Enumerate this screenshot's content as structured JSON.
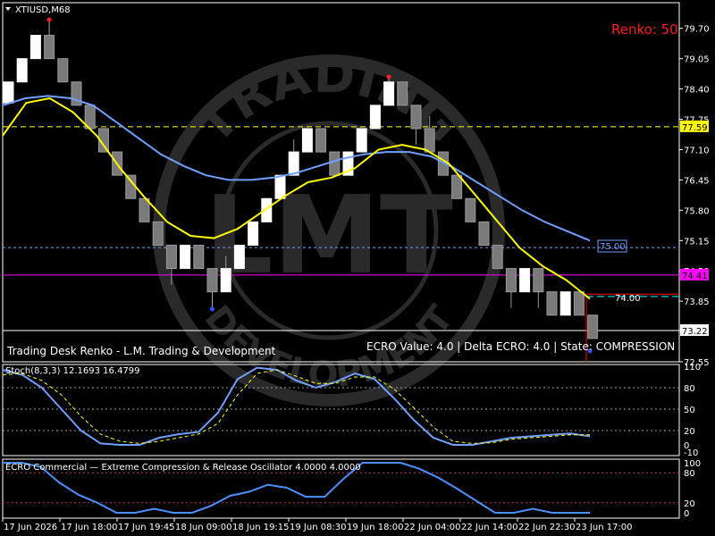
{
  "symbol_label": "XTIUSD,M68",
  "renko_label": "Renko: 50",
  "footer_left": "Trading Desk Renko - L.M. Trading & Development",
  "footer_right": "ECRO Value: 4.0   |   Delta ECRO: 4.0   |   State: COMPRESSION",
  "watermark": {
    "text_top": "TRADING",
    "text_center": "LMT",
    "text_bottom": "DEVELOPMENT"
  },
  "price_axis": [
    "79.70",
    "79.05",
    "78.40",
    "77.75",
    "77.10",
    "76.45",
    "75.80",
    "75.15",
    "74.50",
    "73.85",
    "73.22",
    "72.55"
  ],
  "price_markers": [
    {
      "value": "77.59",
      "color": "#ffff00",
      "text_color": "#000000"
    },
    {
      "value": "74.41",
      "color": "#ff00ff",
      "text_color": "#000000"
    },
    {
      "value": "73.22",
      "color": "#ffffff",
      "text_color": "#000000"
    }
  ],
  "line_labels": [
    {
      "text": "75.00",
      "color": "#6f9fff"
    },
    {
      "text": "74.00",
      "color": "#ffffff"
    }
  ],
  "stoch": {
    "label": "Stoch(8,3,3) 12.1693 16.4799",
    "axis": [
      "110",
      "80",
      "50",
      "20",
      "0",
      "-10"
    ]
  },
  "ecro": {
    "label": "ECRO Commercial — Extreme Compression & Release Oscillator 4.0000 4.0000",
    "axis": [
      "100",
      "80",
      "20",
      "0"
    ]
  },
  "time_axis": [
    "17 Jun 2026",
    "17 Jun 18:00",
    "17 Jun 19:45",
    "18 Jun 09:00",
    "18 Jun 19:15",
    "19 Jun 08:30",
    "19 Jun 18:00",
    "22 Jun 04:00",
    "22 Jun 14:00",
    "22 Jun 22:30",
    "23 Jun 17:00"
  ],
  "chart_data": {
    "type": "candlestick",
    "bricks": [
      {
        "o": 78.1,
        "c": 78.55
      },
      {
        "o": 78.55,
        "c": 79.05
      },
      {
        "o": 79.05,
        "c": 79.55
      },
      {
        "o": 79.55,
        "c": 79.05
      },
      {
        "o": 79.05,
        "c": 78.55
      },
      {
        "o": 78.55,
        "c": 78.05
      },
      {
        "o": 78.05,
        "c": 77.55
      },
      {
        "o": 77.55,
        "c": 77.05
      },
      {
        "o": 77.05,
        "c": 76.55
      },
      {
        "o": 76.55,
        "c": 76.05
      },
      {
        "o": 76.05,
        "c": 75.55
      },
      {
        "o": 75.55,
        "c": 75.05
      },
      {
        "o": 75.05,
        "c": 74.55
      },
      {
        "o": 74.55,
        "c": 75.05
      },
      {
        "o": 75.05,
        "c": 74.55
      },
      {
        "o": 74.55,
        "c": 74.05
      },
      {
        "o": 74.05,
        "c": 74.55
      },
      {
        "o": 74.55,
        "c": 75.05
      },
      {
        "o": 75.05,
        "c": 75.55
      },
      {
        "o": 75.55,
        "c": 76.05
      },
      {
        "o": 76.05,
        "c": 76.55
      },
      {
        "o": 76.55,
        "c": 77.05
      },
      {
        "o": 77.05,
        "c": 77.55
      },
      {
        "o": 77.55,
        "c": 77.05
      },
      {
        "o": 77.05,
        "c": 76.55
      },
      {
        "o": 76.55,
        "c": 77.05
      },
      {
        "o": 77.05,
        "c": 77.55
      },
      {
        "o": 77.55,
        "c": 78.05
      },
      {
        "o": 78.05,
        "c": 78.55
      },
      {
        "o": 78.55,
        "c": 78.05
      },
      {
        "o": 78.05,
        "c": 77.55
      },
      {
        "o": 77.55,
        "c": 77.05
      },
      {
        "o": 77.05,
        "c": 76.55
      },
      {
        "o": 76.55,
        "c": 76.05
      },
      {
        "o": 76.05,
        "c": 75.55
      },
      {
        "o": 75.55,
        "c": 75.05
      },
      {
        "o": 75.05,
        "c": 74.55
      },
      {
        "o": 74.55,
        "c": 74.05
      },
      {
        "o": 74.05,
        "c": 74.55
      },
      {
        "o": 74.55,
        "c": 74.05
      },
      {
        "o": 74.05,
        "c": 73.55
      },
      {
        "o": 73.55,
        "c": 74.05
      },
      {
        "o": 74.05,
        "c": 73.55
      },
      {
        "o": 73.55,
        "c": 73.05
      }
    ],
    "ma_blue": [
      78.05,
      78.2,
      78.25,
      78.2,
      78.05,
      77.7,
      77.35,
      77.0,
      76.75,
      76.55,
      76.45,
      76.45,
      76.5,
      76.6,
      76.75,
      76.9,
      77.0,
      77.05,
      77.05,
      76.95,
      76.7,
      76.4,
      76.1,
      75.8,
      75.55,
      75.35,
      75.15
    ],
    "ma_yellow": [
      77.4,
      78.1,
      78.2,
      77.9,
      77.4,
      76.7,
      76.1,
      75.55,
      75.25,
      75.2,
      75.4,
      75.75,
      76.1,
      76.4,
      76.5,
      76.7,
      77.1,
      77.2,
      77.1,
      76.8,
      76.2,
      75.6,
      75.0,
      74.6,
      74.3,
      73.9
    ],
    "stoch_main": [
      105,
      98,
      80,
      50,
      20,
      2,
      0,
      0,
      10,
      15,
      18,
      45,
      92,
      108,
      105,
      90,
      80,
      88,
      100,
      92,
      65,
      35,
      10,
      0,
      0,
      5,
      10,
      12,
      14,
      16,
      12
    ],
    "stoch_signal": [
      98,
      100,
      90,
      70,
      40,
      15,
      5,
      2,
      5,
      10,
      15,
      30,
      70,
      100,
      105,
      96,
      86,
      86,
      95,
      95,
      78,
      52,
      25,
      5,
      2,
      3,
      8,
      10,
      12,
      14,
      14
    ],
    "ecro_values": [
      100,
      100,
      92,
      60,
      36,
      20,
      0,
      0,
      8,
      0,
      0,
      14,
      34,
      42,
      56,
      50,
      32,
      32,
      68,
      100,
      100,
      100,
      88,
      70,
      48,
      24,
      0,
      0,
      8,
      0,
      0,
      0
    ],
    "levels": {
      "yellow_dash": 77.59,
      "blue_dash": 75.0,
      "magenta_line": 74.41,
      "red_line": 74.0,
      "cyan_dash": 73.95,
      "white_line": 73.22
    },
    "ylim": [
      72.55,
      80.25
    ]
  }
}
